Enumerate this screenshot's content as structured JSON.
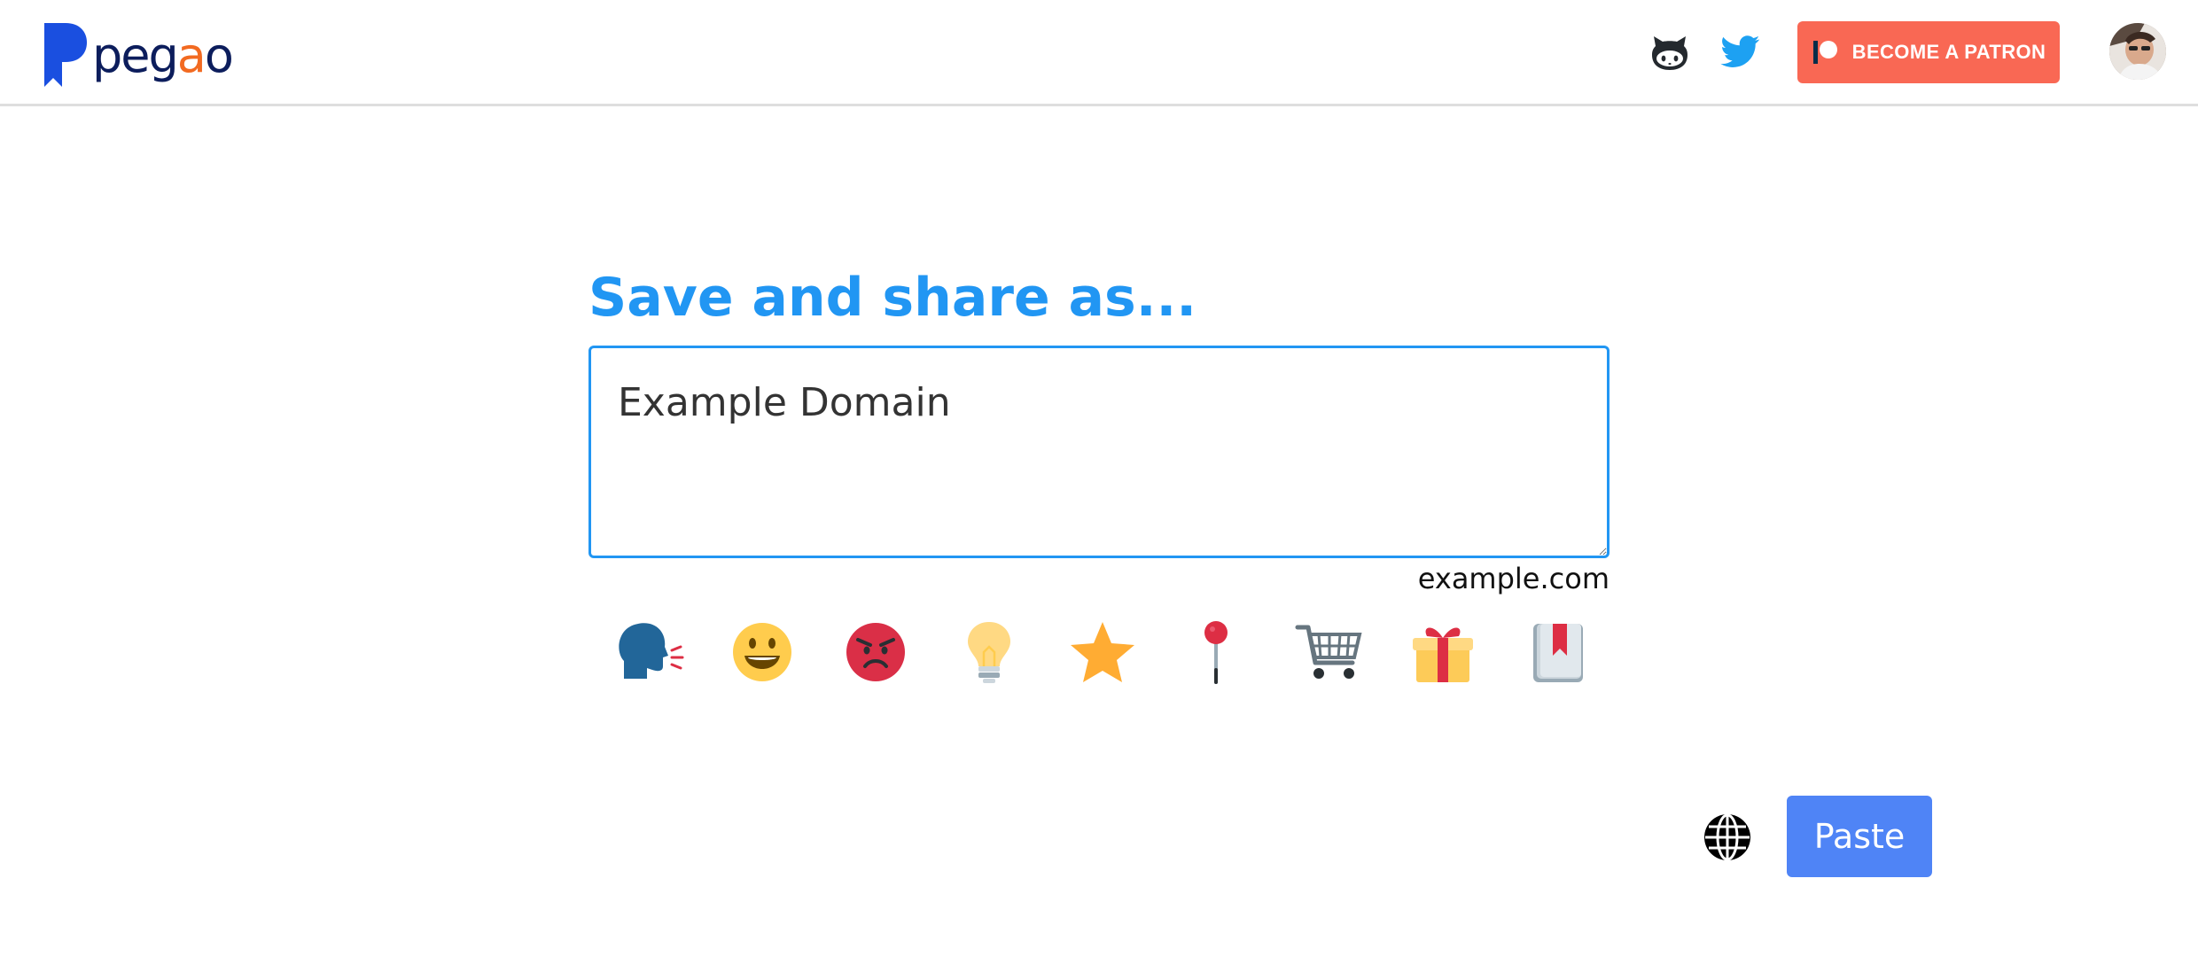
{
  "header": {
    "logo_text_pre": "peg",
    "logo_text_accent": "a",
    "logo_text_post": "o",
    "github_icon": "github-octocat-icon",
    "twitter_icon": "twitter-bird-icon",
    "patron_label": "BECOME A PATRON",
    "patron_icon": "patreon-icon",
    "avatar": "user-avatar"
  },
  "main": {
    "heading": "Save and share as...",
    "title_value": "Example Domain",
    "domain": "example.com",
    "emoji_options": [
      "speaking-head-icon",
      "smiley-face-icon",
      "angry-face-icon",
      "light-bulb-icon",
      "star-icon",
      "pushpin-icon",
      "shopping-cart-icon",
      "gift-icon",
      "bookmark-book-icon"
    ],
    "globe_icon": "globe-icon",
    "paste_label": "Paste"
  },
  "colors": {
    "accent_blue": "#2196f3",
    "patron": "#f96854",
    "paste_button": "#4f84f6",
    "logo_dark": "#0c1d5c",
    "logo_orange": "#f26a21"
  }
}
